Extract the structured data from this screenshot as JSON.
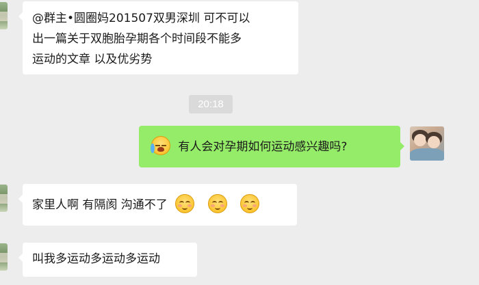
{
  "messages": [
    {
      "side": "left",
      "lines": [
        "@群主•圆圈妈201507双男深圳 可不可以",
        "出一篇关于双胞胎孕期各个时间段不能多",
        "运动的文章 以及优劣势"
      ]
    },
    {
      "type": "timestamp",
      "text": "20:18"
    },
    {
      "side": "right",
      "emoji": "crying-face-icon",
      "text": "有人会对孕期如何运动感兴趣吗?"
    },
    {
      "side": "left",
      "text": "家里人啊 有隔阂 沟通不了",
      "emojis": [
        "smile-icon",
        "smile-icon",
        "smile-icon"
      ]
    },
    {
      "side": "left",
      "text": "叫我多运动多运动多运动"
    }
  ],
  "colors": {
    "background": "#ededed",
    "incoming_bubble": "#ffffff",
    "outgoing_bubble": "#95ec69",
    "timestamp_bg": "#dadada"
  }
}
